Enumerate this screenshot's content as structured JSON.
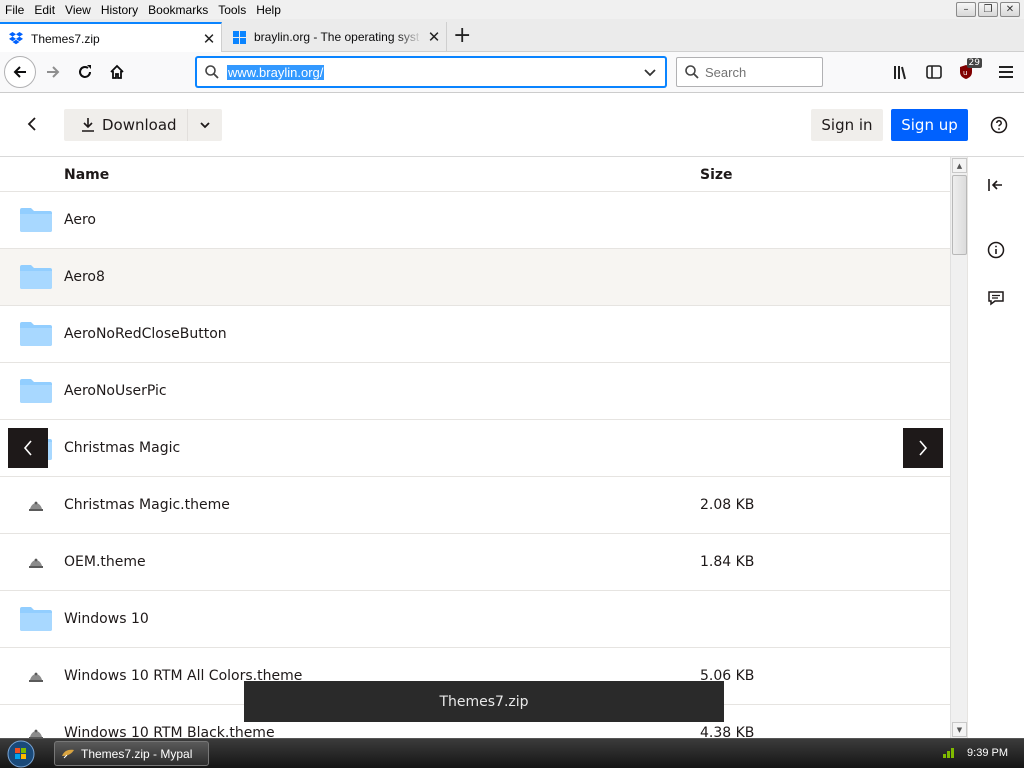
{
  "menubar": {
    "items": [
      "File",
      "Edit",
      "View",
      "History",
      "Bookmarks",
      "Tools",
      "Help"
    ]
  },
  "tabs": [
    {
      "title": "Themes7.zip",
      "active": true,
      "icon": "dropbox-icon"
    },
    {
      "title": "braylin.org - The operating syst",
      "active": false,
      "icon": "windows-icon"
    }
  ],
  "navbar": {
    "url": "www.braylin.org/",
    "search_placeholder": "Search",
    "ublock_badge": "29"
  },
  "dropbox": {
    "download_label": "Download",
    "signin_label": "Sign in",
    "signup_label": "Sign up",
    "accent": "#0061fe"
  },
  "file_list": {
    "col_name": "Name",
    "col_size": "Size",
    "rows": [
      {
        "name": "Aero",
        "size": "",
        "type": "folder"
      },
      {
        "name": "Aero8",
        "size": "",
        "type": "folder"
      },
      {
        "name": "AeroNoRedCloseButton",
        "size": "",
        "type": "folder"
      },
      {
        "name": "AeroNoUserPic",
        "size": "",
        "type": "folder"
      },
      {
        "name": "Christmas Magic",
        "size": "",
        "type": "folder"
      },
      {
        "name": "Christmas Magic.theme",
        "size": "2.08 KB",
        "type": "file"
      },
      {
        "name": "OEM.theme",
        "size": "1.84 KB",
        "type": "file"
      },
      {
        "name": "Windows 10",
        "size": "",
        "type": "folder"
      },
      {
        "name": "Windows 10 RTM All Colors.theme",
        "size": "5.06 KB",
        "type": "file"
      },
      {
        "name": "Windows 10 RTM Black.theme",
        "size": "4.38 KB",
        "type": "file"
      }
    ]
  },
  "toast": {
    "text": "Themes7.zip"
  },
  "taskbar": {
    "item_label": "Themes7.zip - Mypal",
    "clock": "9:39 PM"
  }
}
